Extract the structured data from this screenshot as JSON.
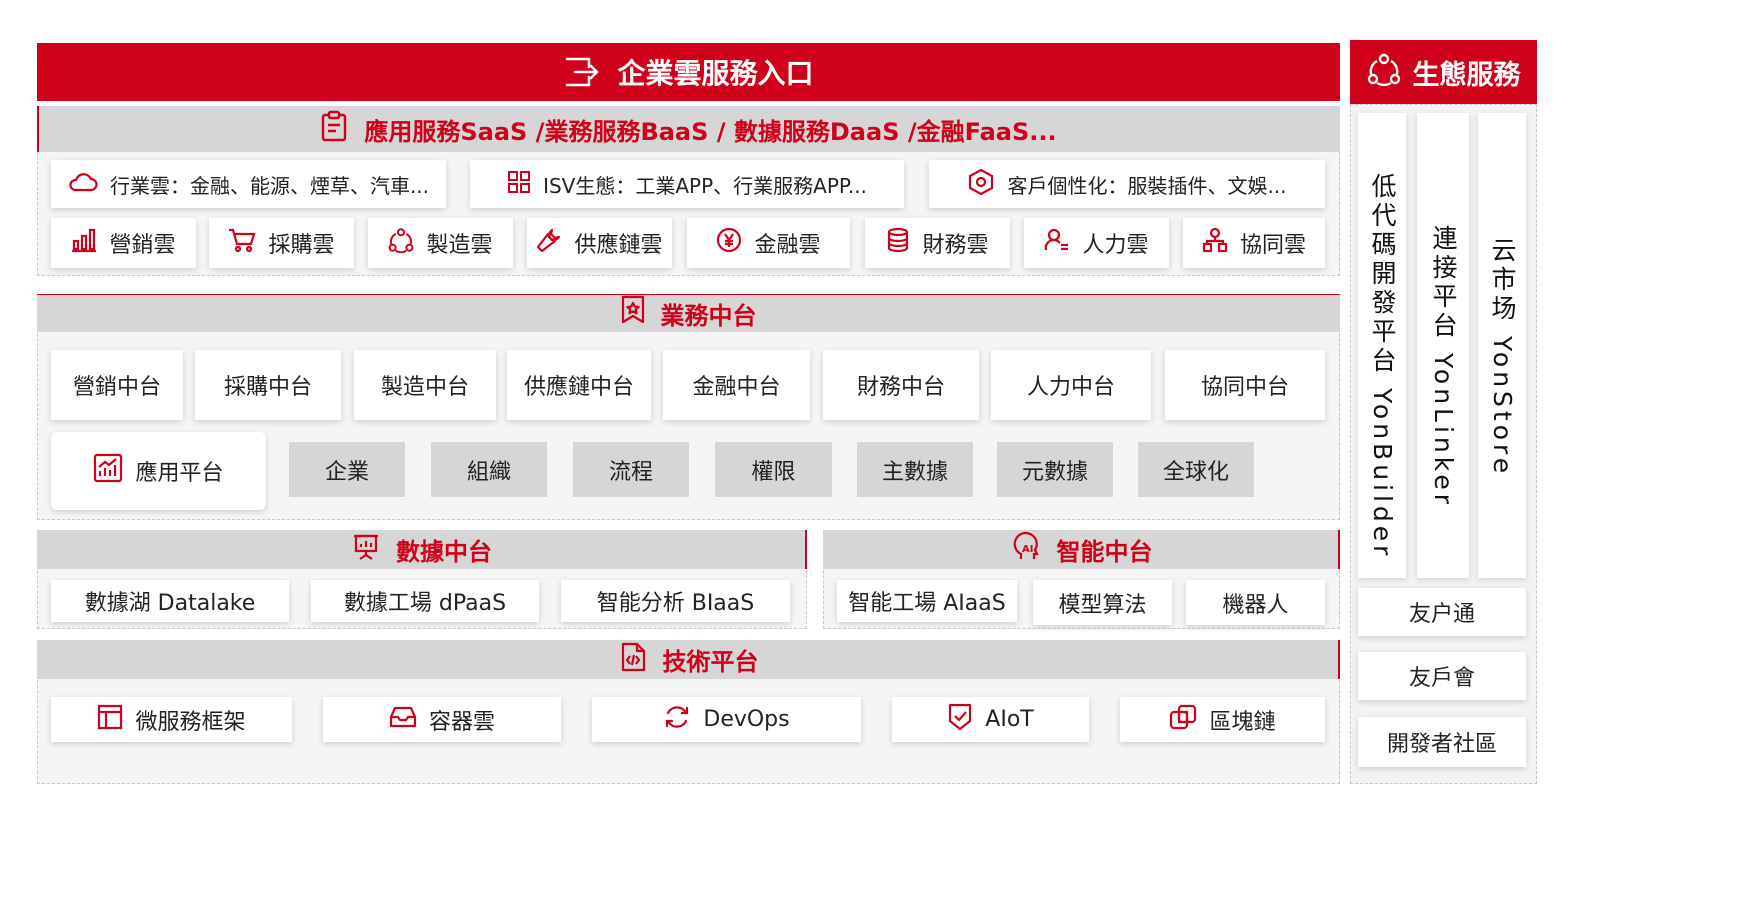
{
  "header": {
    "title": "企業雲服務入口",
    "icon": "exit-door-icon"
  },
  "ecosystem": {
    "title": "生態服務",
    "icon": "network-nodes-icon",
    "columns": [
      "低代碼開發平台 YonBuilder",
      "連接平台 YonLinker",
      "云市场 YonStore"
    ],
    "items": [
      "友户通",
      "友戶會",
      "開發者社區"
    ]
  },
  "saas": {
    "title": "應用服務SaaS /業務服務BaaS / 數據服務DaaS /金融FaaS...",
    "icon": "clipboard-icon",
    "wide_cards": [
      {
        "label": "行業雲：金融、能源、煙草、汽車...",
        "icon": "cloud-icon"
      },
      {
        "label": "ISV生態：工業APP、行業服務APP...",
        "icon": "apps-grid-icon"
      },
      {
        "label": "客戶個性化：服裝插件、文娛...",
        "icon": "hexagon-icon"
      }
    ],
    "cards": [
      {
        "label": "營銷雲",
        "icon": "bar-chart-icon"
      },
      {
        "label": "採購雲",
        "icon": "shopping-cart-icon"
      },
      {
        "label": "製造雲",
        "icon": "network-nodes-icon"
      },
      {
        "label": "供應鏈雲",
        "icon": "wrench-icon"
      },
      {
        "label": "金融雲",
        "icon": "yen-icon"
      },
      {
        "label": "財務雲",
        "icon": "database-icon"
      },
      {
        "label": "人力雲",
        "icon": "user-list-icon"
      },
      {
        "label": "協同雲",
        "icon": "org-chart-icon"
      }
    ]
  },
  "business": {
    "title": "業務中台",
    "icon": "badge-icon",
    "cards": [
      "營銷中台",
      "採購中台",
      "製造中台",
      "供應鏈中台",
      "金融中台",
      "財務中台",
      "人力中台",
      "協同中台"
    ],
    "app_platform": {
      "label": "應用平台",
      "icon": "chart-up-icon"
    },
    "gray_cards": [
      "企業",
      "組織",
      "流程",
      "權限",
      "主數據",
      "元數據",
      "全球化"
    ]
  },
  "data": {
    "title": "數據中台",
    "icon": "presentation-icon",
    "cards": [
      "數據湖 Datalake",
      "數據工場 dPaaS",
      "智能分析 BIaaS"
    ]
  },
  "ai": {
    "title": "智能中台",
    "icon": "ai-head-icon",
    "cards": [
      "智能工場 AIaaS",
      "模型算法",
      "機器人"
    ]
  },
  "tech": {
    "title": "技術平台",
    "icon": "code-file-icon",
    "cards": [
      {
        "label": "微服務框架",
        "icon": "layout-icon"
      },
      {
        "label": "容器雲",
        "icon": "tray-icon"
      },
      {
        "label": "DevOps",
        "icon": "refresh-icon"
      },
      {
        "label": "AIoT",
        "icon": "shield-check-icon"
      },
      {
        "label": "區塊鏈",
        "icon": "chain-icon"
      }
    ]
  },
  "colors": {
    "accent": "#d0021b",
    "gray_bar": "#d6d6d6",
    "panel": "#f5f5f5"
  }
}
